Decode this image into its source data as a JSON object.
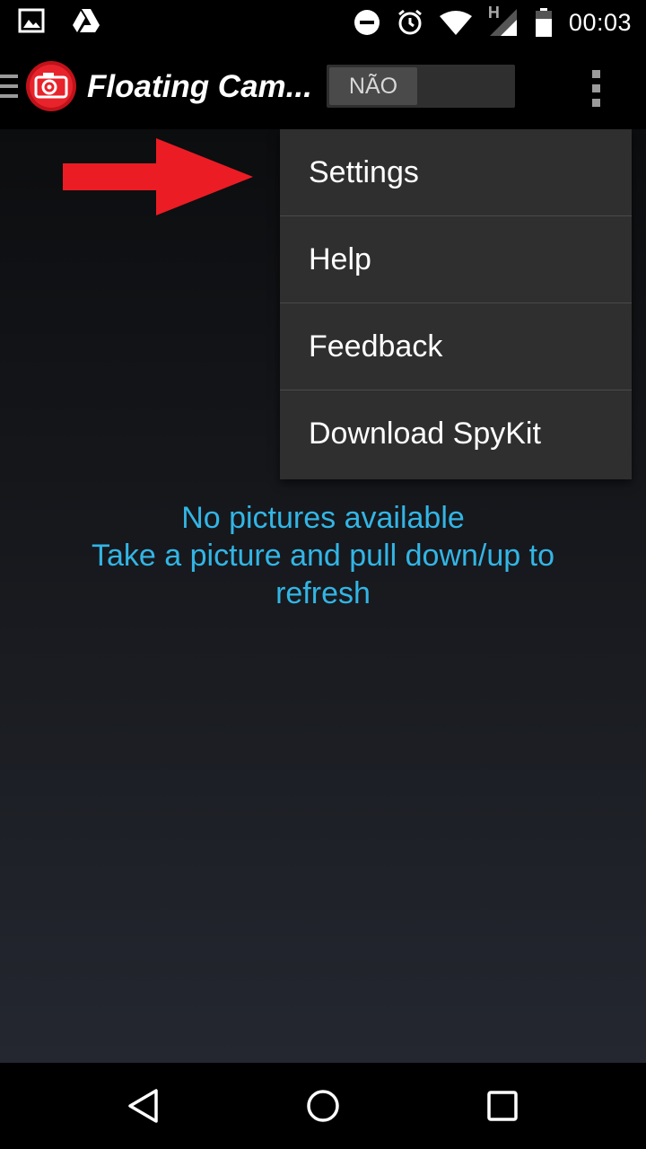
{
  "status_bar": {
    "time": "00:03",
    "network_label": "H",
    "icons": [
      "image-icon",
      "drive-icon",
      "do-not-disturb-icon",
      "alarm-icon",
      "wifi-icon",
      "signal-icon",
      "battery-icon"
    ]
  },
  "action_bar": {
    "title": "Floating Cam...",
    "toggle_label": "NÃO",
    "icons": [
      "drawer-icon",
      "app-camera-logo-icon",
      "overflow-menu-icon"
    ]
  },
  "menu": {
    "items": [
      {
        "label": "Settings"
      },
      {
        "label": "Help"
      },
      {
        "label": "Feedback"
      },
      {
        "label": "Download SpyKit"
      }
    ]
  },
  "content": {
    "empty_line1": "No pictures available",
    "empty_line2": "Take a picture and pull down/up to",
    "empty_line3": "refresh"
  },
  "annotation": {
    "arrow_icon": "red-arrow-icon",
    "arrow_color": "#ec1c24"
  },
  "nav_bar": {
    "icons": [
      "back-icon",
      "home-icon",
      "recents-icon"
    ]
  },
  "colors": {
    "accent": "#33b5e5",
    "menu_bg": "#2f2f2f",
    "background": "#000000"
  }
}
